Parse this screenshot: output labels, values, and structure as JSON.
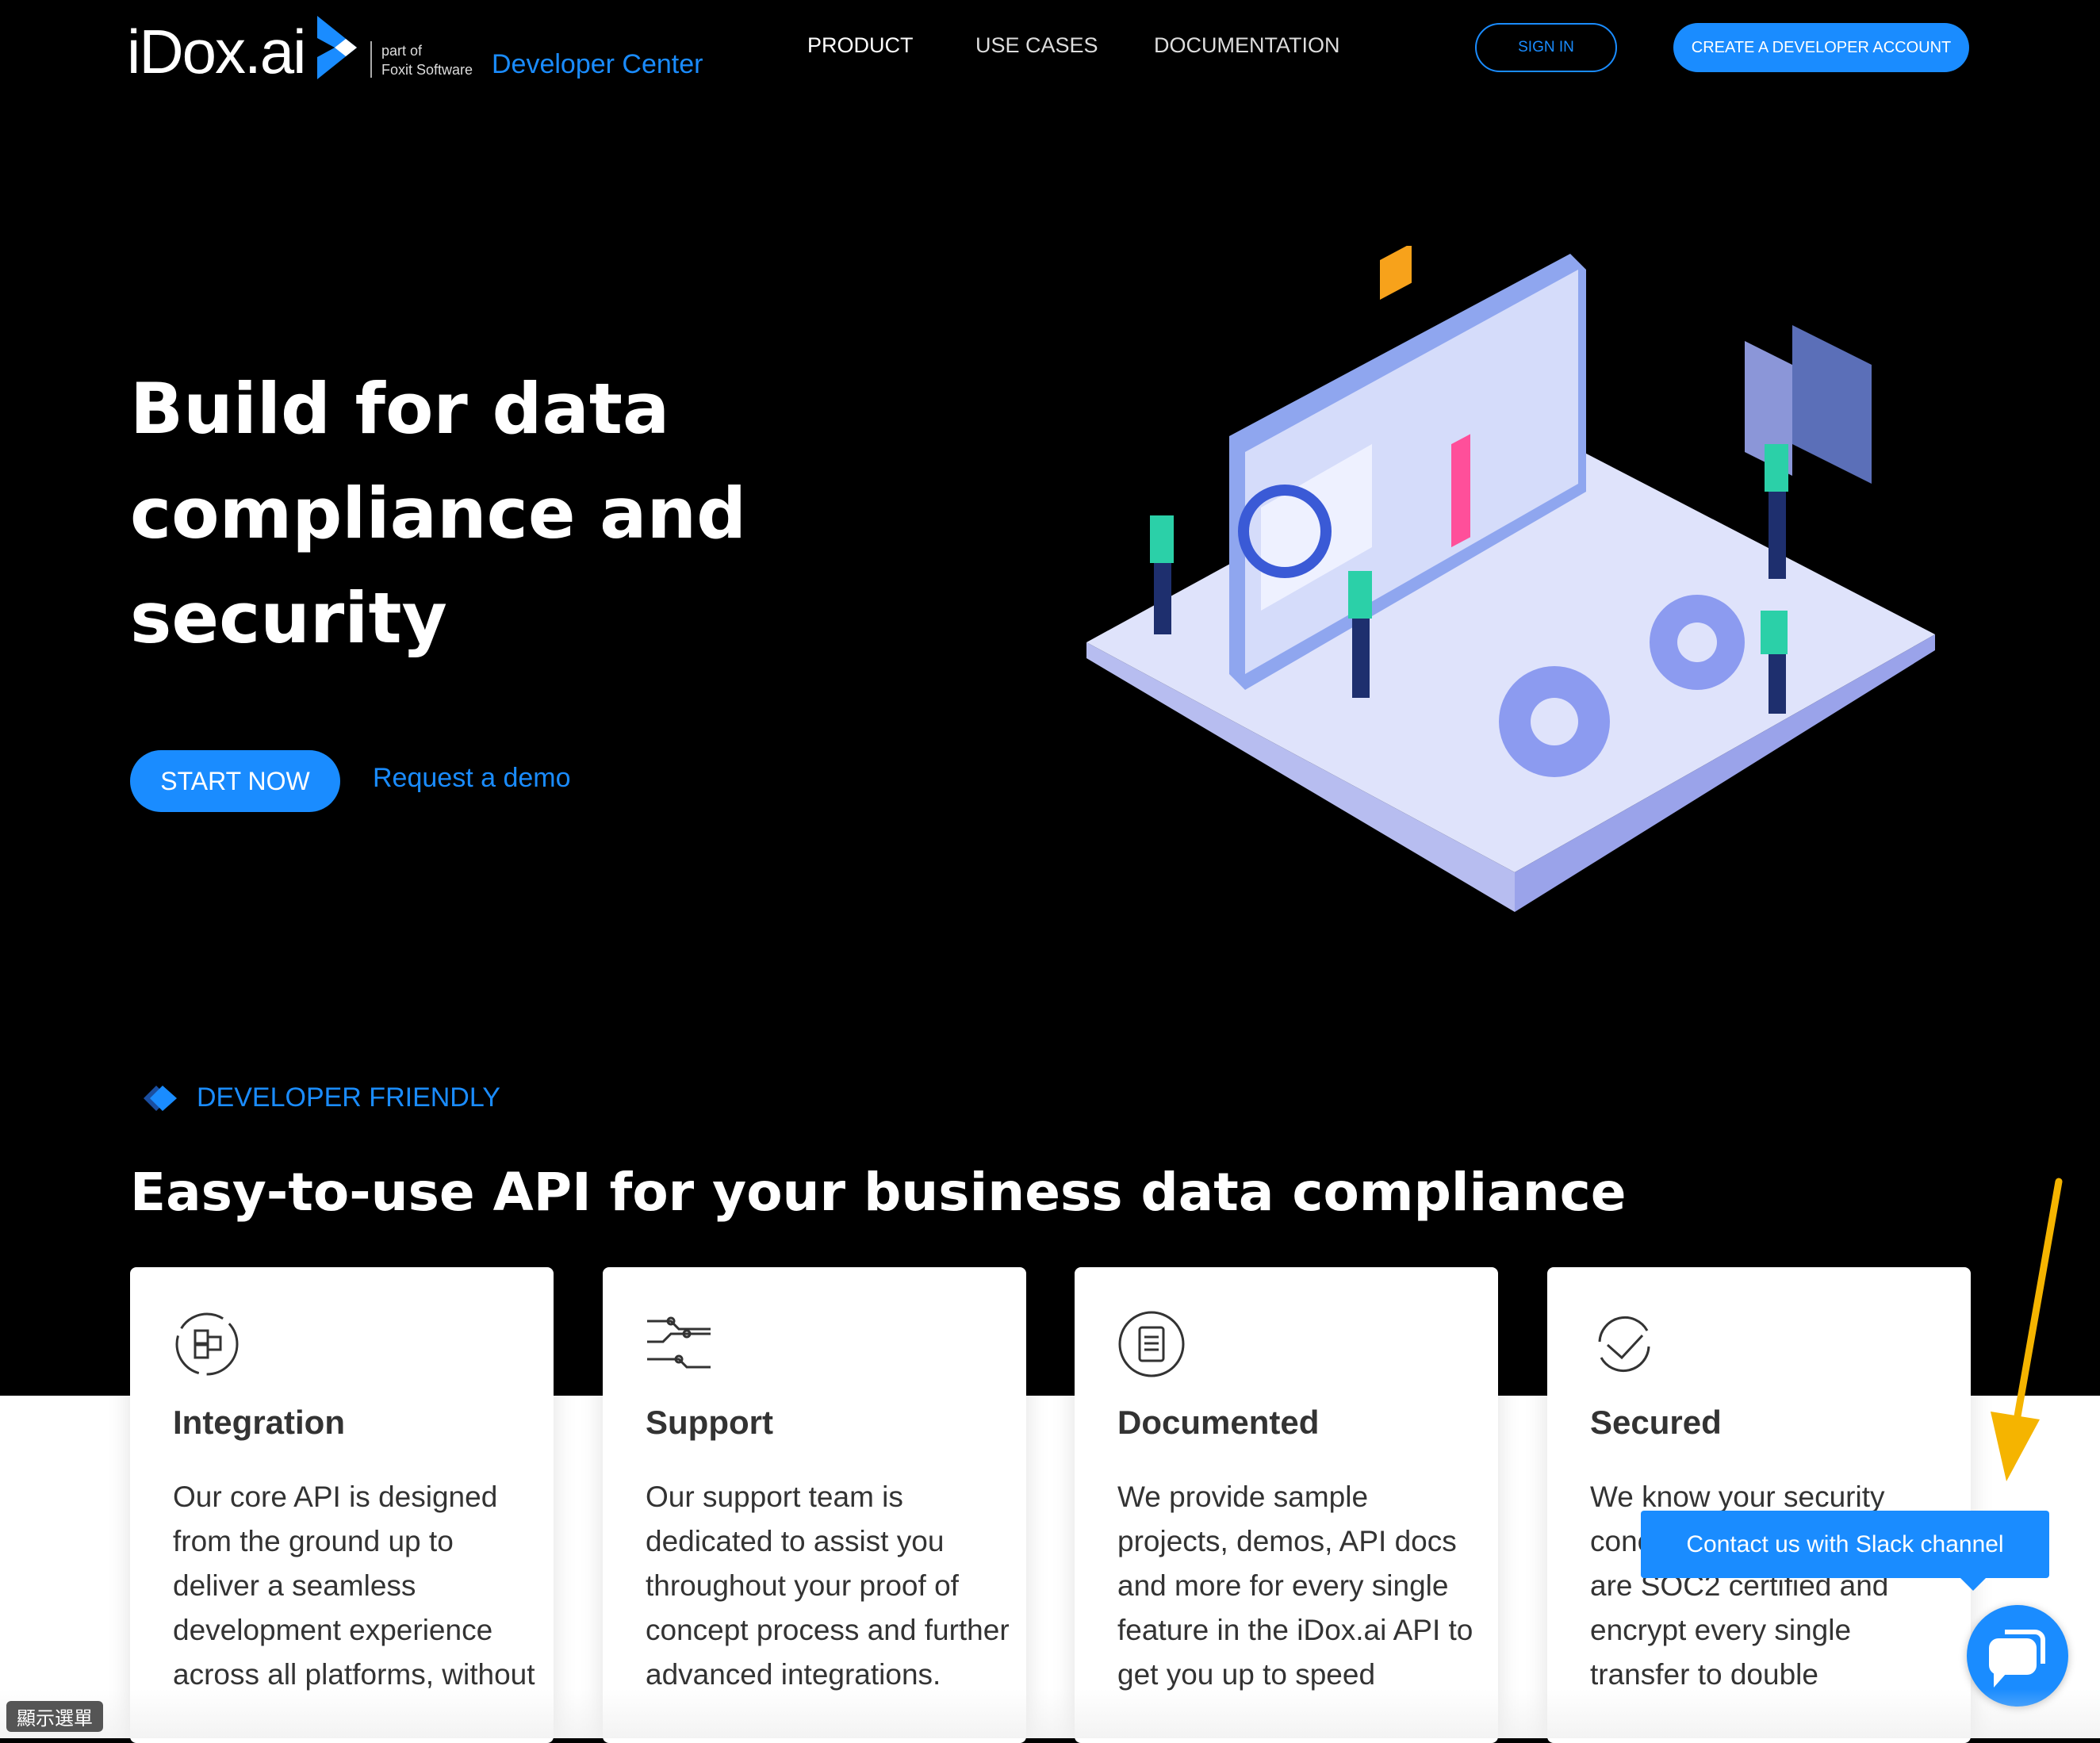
{
  "header": {
    "logo": "iDox.ai",
    "part_of": "part of",
    "foxit": "Foxit Software",
    "dev_center": "Developer Center",
    "nav": [
      "PRODUCT",
      "USE CASES",
      "DOCUMENTATION"
    ],
    "sign_in": "SIGN IN",
    "create_account": "CREATE A DEVELOPER ACCOUNT"
  },
  "hero": {
    "title_lines": [
      "Build for data",
      "compliance and",
      "security"
    ],
    "start": "START NOW",
    "demo": "Request a demo"
  },
  "section": {
    "eyebrow": "DEVELOPER FRIENDLY",
    "heading": "Easy-to-use API for your business data compliance"
  },
  "cards": [
    {
      "icon": "cubes-icon",
      "title": "Integration",
      "body": "Our core API is designed from the ground up to deliver a seamless development experience across all platforms, without"
    },
    {
      "icon": "circuit-icon",
      "title": "Support",
      "body": "Our support team is dedicated to assist you throughout your proof of concept process and further advanced integrations."
    },
    {
      "icon": "clipboard-icon",
      "title": "Documented",
      "body": "We provide sample projects, demos, API docs and more for every single feature in the iDox.ai API to get you up to speed"
    },
    {
      "icon": "shield-check-icon",
      "title": "Secured",
      "body": "We know your security concerns, even more. We are SOC2 certified and encrypt every single transfer to double"
    }
  ],
  "chat": {
    "tooltip": "Contact us with Slack channel"
  },
  "overlay": {
    "menu_badge": "顯示選單"
  },
  "colors": {
    "accent": "#1a8cff",
    "arrow": "#f5b400",
    "background": "#000000"
  }
}
